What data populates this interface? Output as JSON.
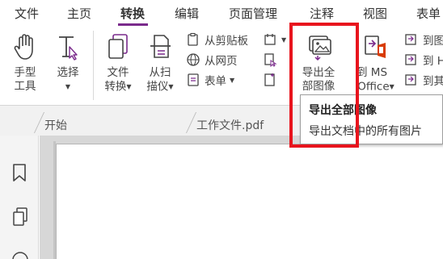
{
  "menu": {
    "items": [
      "文件",
      "主页",
      "转换",
      "编辑",
      "页面管理",
      "注释",
      "视图",
      "表单"
    ],
    "active_index": 2
  },
  "ribbon": {
    "hand_tool": {
      "line1": "手型",
      "line2": "工具",
      "icon": "hand-icon"
    },
    "select_tool": {
      "line1": "选择",
      "icon": "text-cursor-icon"
    },
    "file_convert": {
      "line1": "文件",
      "line2": "转换",
      "icon": "file-stack-icon"
    },
    "from_scanner": {
      "line1": "从扫",
      "line2": "描仪",
      "icon": "scanner-icon"
    },
    "from_clipboard": "从剪贴板",
    "from_webpage": "从网页",
    "form": "表单",
    "export_all_images": {
      "line1": "导出全",
      "line2": "部图像",
      "icon": "export-images-icon"
    },
    "to_ms_office": {
      "line1": "到 MS",
      "line2": "Office",
      "icon": "office-icon"
    },
    "to_image": "到图",
    "to_html": "到 H",
    "to_other": "到其"
  },
  "tabs": {
    "start": "开始",
    "document": "工作文件.pdf"
  },
  "tooltip": {
    "title": "导出全部图像",
    "description": "导出文档中的所有图片"
  },
  "colors": {
    "accent": "#7a2a8c",
    "highlight_border": "#e8141d",
    "office": "#d83b01"
  }
}
